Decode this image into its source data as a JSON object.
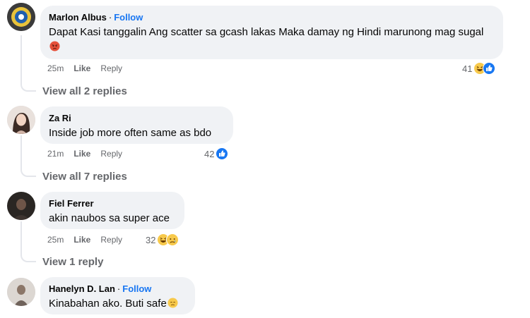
{
  "comments": [
    {
      "name": "Marlon Albus",
      "follow": "Follow",
      "text": "Dapat Kasi tanggalin Ang scatter sa gcash lakas Maka damay ng Hindi marunong mag sugal",
      "time": "25m",
      "like": "Like",
      "reply": "Reply",
      "reactions": "41",
      "view_replies": "View all 2 replies"
    },
    {
      "name": "Za Ri",
      "text": "Inside job more often same as bdo",
      "time": "21m",
      "like": "Like",
      "reply": "Reply",
      "reactions": "42",
      "view_replies": "View all 7 replies"
    },
    {
      "name": "Fiel Ferrer",
      "text": "akin naubos sa super ace",
      "time": "25m",
      "like": "Like",
      "reply": "Reply",
      "reactions": "32",
      "view_replies": "View 1 reply"
    },
    {
      "name": "Hanelyn D. Lan",
      "follow": "Follow",
      "text": "Kinabahan ako. Buti safe"
    }
  ],
  "separator": "·",
  "colors": {
    "link": "#1876f2",
    "muted": "#65676b",
    "bubble": "#f0f2f5"
  },
  "icons": [
    "angry-emoji-icon",
    "haha-reaction-icon",
    "like-reaction-icon",
    "sad-reaction-icon",
    "relieved-emoji-icon"
  ]
}
